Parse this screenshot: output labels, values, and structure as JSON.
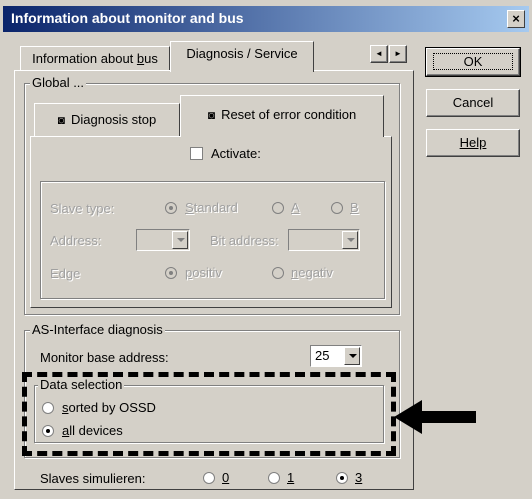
{
  "window": {
    "title": "Information about monitor and bus",
    "close_glyph": "×"
  },
  "buttons": {
    "ok": "OK",
    "cancel": "Cancel",
    "help": "Help"
  },
  "tabs": [
    {
      "label_pre": "Information about ",
      "label_u": "b",
      "label_post": "us"
    },
    {
      "label": "Diagnosis / Service"
    }
  ],
  "tab_scroll": {
    "left": "◄",
    "right": "►"
  },
  "global": {
    "label": "Global ...",
    "inner_tabs": [
      "Diagnosis stop",
      "Reset of error condition"
    ],
    "activate_label": "Activate:",
    "slave_type": {
      "label": "Slave type:",
      "options": [
        {
          "u": "S",
          "rest": "tandard"
        },
        {
          "u": "A",
          "rest": ""
        },
        {
          "u": "B",
          "rest": ""
        }
      ]
    },
    "address_label": "Address:",
    "bit_address_label": "Bit address:",
    "edge": {
      "label": "Edge",
      "options": [
        {
          "u": "p",
          "rest": "ositiv"
        },
        {
          "u": "n",
          "rest": "egativ"
        }
      ]
    }
  },
  "asi": {
    "label": "AS-Interface diagnosis",
    "monitor_base_label": "Monitor base address:",
    "monitor_base_value": "25"
  },
  "data_selection": {
    "label": "Data selection",
    "options": [
      {
        "u": "s",
        "rest": "orted by OSSD",
        "selected": false
      },
      {
        "u": "a",
        "rest": "ll devices",
        "selected": true
      }
    ]
  },
  "slaves": {
    "label": "Slaves simulieren:",
    "options": [
      {
        "u": "0",
        "selected": false
      },
      {
        "u": "1",
        "selected": false
      },
      {
        "u": "3",
        "selected": true
      }
    ]
  }
}
